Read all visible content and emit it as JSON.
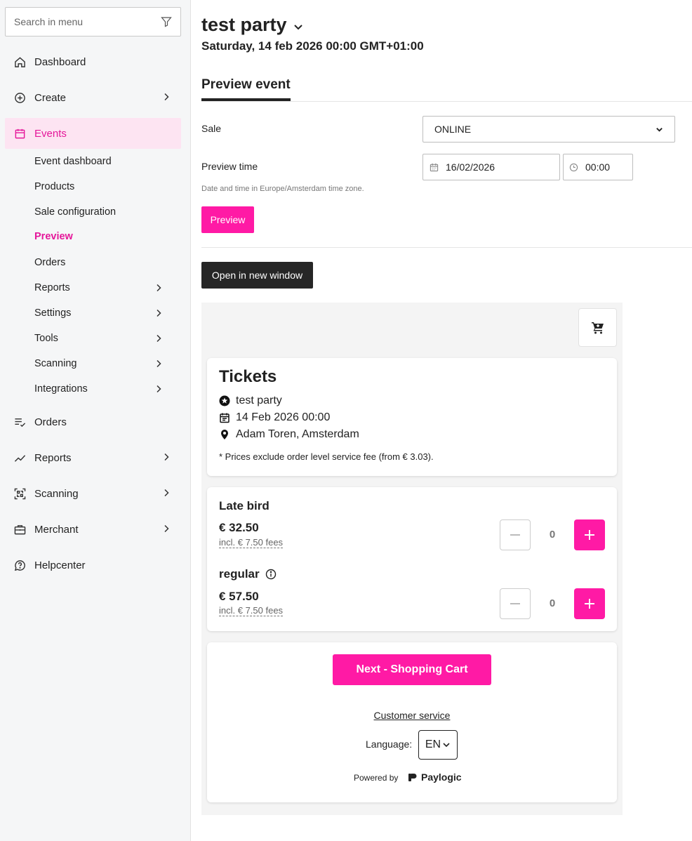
{
  "sidebar": {
    "search_placeholder": "Search in menu",
    "items": [
      {
        "label": "Dashboard"
      },
      {
        "label": "Create"
      },
      {
        "label": "Events"
      },
      {
        "label": "Orders"
      },
      {
        "label": "Reports"
      },
      {
        "label": "Scanning"
      },
      {
        "label": "Merchant"
      },
      {
        "label": "Helpcenter"
      }
    ],
    "event_sub": [
      {
        "label": "Event dashboard"
      },
      {
        "label": "Products"
      },
      {
        "label": "Sale configuration"
      },
      {
        "label": "Preview"
      },
      {
        "label": "Orders"
      },
      {
        "label": "Reports"
      },
      {
        "label": "Settings"
      },
      {
        "label": "Tools"
      },
      {
        "label": "Scanning"
      },
      {
        "label": "Integrations"
      }
    ],
    "accent_color": "#e5179a"
  },
  "header": {
    "title": "test party",
    "subtitle": "Saturday, 14 feb 2026 00:00 GMT+01:00",
    "tab": "Preview event"
  },
  "form": {
    "sale_label": "Sale",
    "sale_value": "ONLINE",
    "preview_time_label": "Preview time",
    "date_value": "16/02/2026",
    "time_value": "00:00",
    "hint": "Date and time in Europe/Amsterdam time zone.",
    "preview_button": "Preview",
    "open_button": "Open in new window"
  },
  "shop": {
    "tickets_title": "Tickets",
    "event_name": "test party",
    "event_date": "14 Feb 2026 00:00",
    "event_location": "Adam Toren, Amsterdam",
    "note": "* Prices exclude order level service fee (from € 3.03).",
    "products": [
      {
        "name": "Late bird",
        "price": "€ 32.50",
        "fees": "incl. € 7.50 fees",
        "qty": "0"
      },
      {
        "name": "regular",
        "price": "€ 57.50",
        "fees": "incl. € 7.50 fees",
        "qty": "0"
      }
    ],
    "next_button": "Next - Shopping Cart",
    "customer_service": "Customer service",
    "language_label": "Language:",
    "language_value": "EN",
    "powered_by": "Powered by",
    "brand": "Paylogic",
    "brand_color": "#ff1aa5"
  }
}
